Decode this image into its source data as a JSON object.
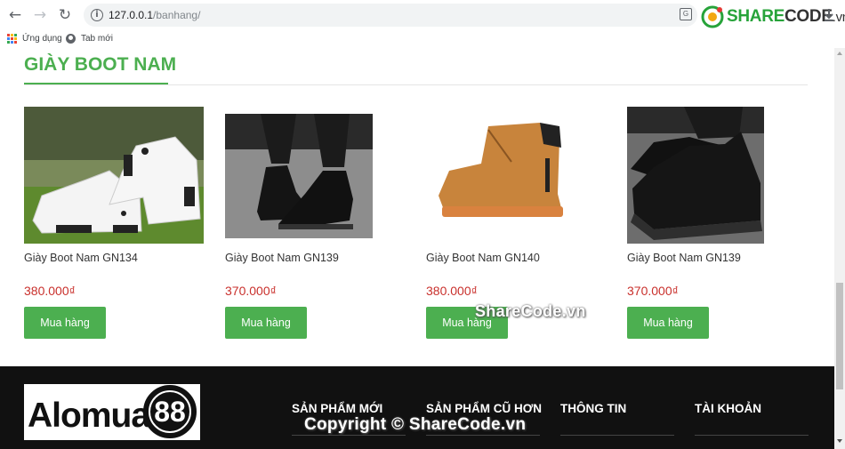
{
  "browser": {
    "url_host": "127.0.0.1",
    "url_path": "/banhang/",
    "bookmarks": [
      {
        "label": "Ứng dụng",
        "icon": "apps-icon"
      },
      {
        "label": "Tab mới",
        "icon": "globe-icon"
      }
    ],
    "colors": {
      "toolbar": "#ffffff",
      "omnibox": "#f1f3f4"
    }
  },
  "watermark": {
    "brand_green": "SHARE",
    "brand_dark": "CODE",
    "brand_suffix": ".vn",
    "mid_text": "ShareCode.vn",
    "footer_text": "Copyright © ShareCode.vn"
  },
  "section": {
    "title": "GIÀY BOOT NAM",
    "accent_color": "#4caf50"
  },
  "products": [
    {
      "name": "Giày Boot Nam GN134",
      "price": "380.000₫",
      "button": "Mua hàng"
    },
    {
      "name": "Giày Boot Nam GN139",
      "price": "370.000₫",
      "button": "Mua hàng"
    },
    {
      "name": "Giày Boot Nam GN140",
      "price": "380.000₫",
      "button": "Mua hàng"
    },
    {
      "name": "Giày Boot Nam GN139",
      "price": "370.000₫",
      "button": "Mua hàng"
    }
  ],
  "footer": {
    "logo_word": "Alomua",
    "logo_number": "88",
    "columns": [
      "SẢN PHẨM MỚI",
      "SẢN PHẨM CŨ HƠN",
      "THÔNG TIN",
      "TÀI KHOẢN"
    ]
  }
}
